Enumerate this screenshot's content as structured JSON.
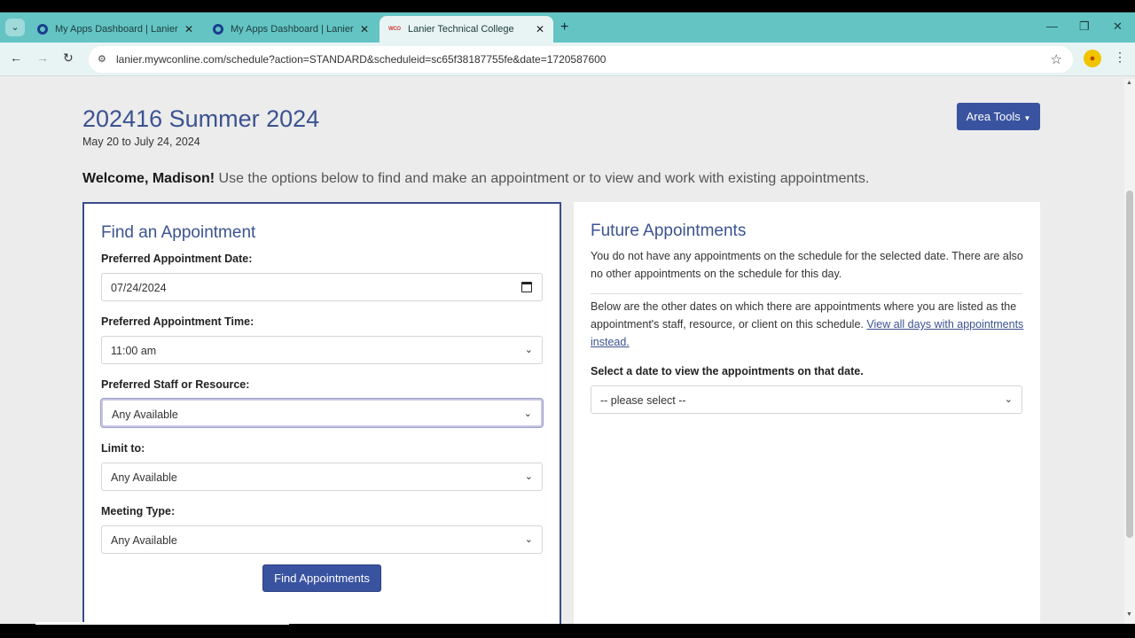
{
  "browser": {
    "tabs": [
      {
        "title": "My Apps Dashboard | Lanier Te",
        "active": false
      },
      {
        "title": "My Apps Dashboard | Lanier Te",
        "active": false
      },
      {
        "title": "Lanier Technical College",
        "active": true
      }
    ],
    "tab_favicon_text": "WCO",
    "url": "lanier.mywconline.com/schedule?action=STANDARD&scheduleid=sc65f38187755fe&date=1720587600"
  },
  "header": {
    "title": "202416 Summer 2024",
    "date_range": "May 20 to July 24, 2024",
    "area_tools_label": "Area Tools",
    "welcome_name": "Welcome, Madison!",
    "welcome_text": " Use the options below to find and make an appointment or to view and work with existing appointments."
  },
  "find": {
    "title": "Find an Appointment",
    "date_label": "Preferred Appointment Date:",
    "date_value": "07/24/2024",
    "time_label": "Preferred Appointment Time:",
    "time_value": "11:00 am",
    "staff_label": "Preferred Staff or Resource:",
    "staff_value": "Any Available",
    "limit_label": "Limit to:",
    "limit_value": "Any Available",
    "meeting_label": "Meeting Type:",
    "meeting_value": "Any Available",
    "button_label": "Find Appointments"
  },
  "future": {
    "title": "Future Appointments",
    "no_appts_text": "You do not have any appointments on the schedule for the selected date. There are also no other appointments on the schedule for this day.",
    "other_dates_text": "Below are the other dates on which there are appointments where you are listed as the appointment's staff, resource, or client on this schedule. ",
    "view_all_link": "View all days with appointments instead.",
    "select_label": "Select a date to view the appointments on that date.",
    "select_value": "-- please select --"
  },
  "colors": {
    "accent": "#3a53a0",
    "tabstrip": "#64c4c4",
    "title": "#3b5391"
  }
}
